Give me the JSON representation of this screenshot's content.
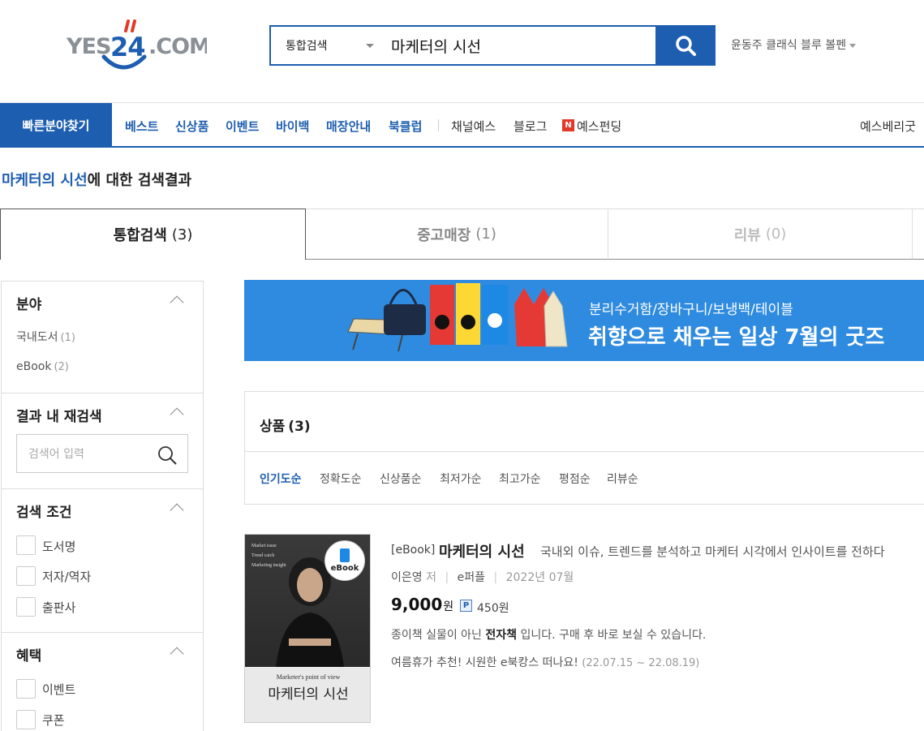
{
  "header": {
    "logo_text": "YES24.COM",
    "search": {
      "category": "통합검색",
      "query": "마케터의 시선",
      "placeholder": ""
    },
    "promo_link": "윤동주 클래식 블루 볼펜"
  },
  "nav": {
    "quick_button": "빠른분야찾기",
    "primary": [
      "베스트",
      "신상품",
      "이벤트",
      "바이백",
      "매장안내",
      "북클럽"
    ],
    "secondary": [
      "채널예스",
      "블로그",
      "예스펀딩"
    ],
    "n_badge": "N",
    "right_link": "예스베리굿"
  },
  "result": {
    "keyword": "마케터의 시선",
    "suffix": "에 대한 검색결과"
  },
  "tabs": [
    {
      "label": "통합검색",
      "count": "(3)"
    },
    {
      "label": "중고매장",
      "count": "(1)"
    },
    {
      "label": "리뷰",
      "count": "(0)"
    }
  ],
  "sidebar": {
    "category": {
      "title": "분야",
      "items": [
        {
          "label": "국내도서",
          "count": "(1)"
        },
        {
          "label": "eBook",
          "count": "(2)"
        }
      ]
    },
    "refine": {
      "title": "결과 내 재검색",
      "placeholder": "검색어 입력"
    },
    "conditions": {
      "title": "검색 조건",
      "items": [
        "도서명",
        "저자/역자",
        "출판사"
      ]
    },
    "benefits": {
      "title": "혜택",
      "items": [
        "이벤트",
        "쿠폰"
      ]
    }
  },
  "banner": {
    "sub": "분리수거함/장바구니/보냉백/테이블",
    "main": "취향으로 채우는 일상 7월의 굿즈"
  },
  "products": {
    "title": "상품",
    "count": "(3)",
    "sort_options": [
      "인기도순",
      "정확도순",
      "신상품순",
      "최저가순",
      "최고가순",
      "평점순",
      "리뷰순"
    ]
  },
  "item": {
    "type": "[eBook]",
    "title": "마케터의 시선",
    "description": "국내외 이슈, 트렌드를 분석하고 마케터 시각에서 인사이트를 전하다",
    "author": "이은영",
    "author_role": "저",
    "publisher": "e퍼플",
    "date": "2022년 07월",
    "price": "9,000",
    "price_unit": "원",
    "point_label": "P",
    "point": "450원",
    "ebook_note_pre": "종이책 실물이 아닌 ",
    "ebook_note_bold": "전자책",
    "ebook_note_post": " 입니다. 구매 후 바로 보실 수 있습니다.",
    "event": "여름휴가 추천! 시원한 e북캉스 떠나요!",
    "event_date": "(22.07.15 ~ 22.08.19)",
    "cover": {
      "top_lines": [
        "Market issue",
        "Trend catch",
        "Marketing insight"
      ],
      "badge": "eBook",
      "en_title": "Marketer's point of view",
      "kr_title": "마케터의 시선"
    }
  },
  "colors": {
    "brand_blue": "#1e5eb0",
    "banner_blue": "#2f8be0",
    "logo_red": "#e2392a"
  }
}
